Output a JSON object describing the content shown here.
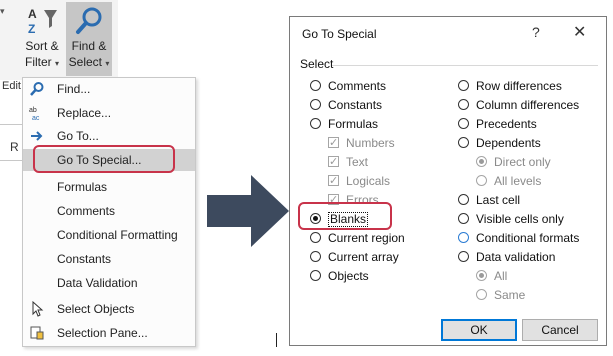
{
  "ribbon": {
    "sort_label_1": "Sort &",
    "sort_label_2": "Filter",
    "find_label_1": "Find &",
    "find_label_2": "Select",
    "dropdown_glyph": "▾",
    "edge_tag": "Edit",
    "cell_letter": "R"
  },
  "menu": {
    "items": [
      {
        "label": "Find...",
        "icon": "magnifier-icon"
      },
      {
        "label": "Replace...",
        "icon": "replace-icon"
      },
      {
        "label": "Go To...",
        "icon": "arrow-right-icon"
      },
      {
        "label": "Go To Special...",
        "icon": ""
      },
      {
        "label": "Formulas",
        "icon": ""
      },
      {
        "label": "Comments",
        "icon": ""
      },
      {
        "label": "Conditional Formatting",
        "icon": ""
      },
      {
        "label": "Constants",
        "icon": ""
      },
      {
        "label": "Data Validation",
        "icon": ""
      },
      {
        "label": "Select Objects",
        "icon": "pointer-icon"
      },
      {
        "label": "Selection Pane...",
        "icon": "selection-pane-icon"
      }
    ],
    "highlighted_index": 3
  },
  "dialog": {
    "title": "Go To Special",
    "help": "?",
    "close": "✕",
    "group_label": "Select",
    "left_options": [
      {
        "label": "Comments",
        "type": "radio",
        "selected": false,
        "disabled": false
      },
      {
        "label": "Constants",
        "type": "radio",
        "selected": false,
        "disabled": false
      },
      {
        "label": "Formulas",
        "type": "radio",
        "selected": false,
        "disabled": false
      },
      {
        "label": "Numbers",
        "type": "checkbox",
        "checked": true,
        "disabled": true
      },
      {
        "label": "Text",
        "type": "checkbox",
        "checked": true,
        "disabled": true
      },
      {
        "label": "Logicals",
        "type": "checkbox",
        "checked": true,
        "disabled": true
      },
      {
        "label": "Errors",
        "type": "checkbox",
        "checked": true,
        "disabled": true
      },
      {
        "label": "Blanks",
        "type": "radio",
        "selected": true,
        "disabled": false
      },
      {
        "label": "Current region",
        "type": "radio",
        "selected": false,
        "disabled": false
      },
      {
        "label": "Current array",
        "type": "radio",
        "selected": false,
        "disabled": false
      },
      {
        "label": "Objects",
        "type": "radio",
        "selected": false,
        "disabled": false
      }
    ],
    "right_options": [
      {
        "label": "Row differences",
        "type": "radio",
        "selected": false,
        "disabled": false
      },
      {
        "label": "Column differences",
        "type": "radio",
        "selected": false,
        "disabled": false
      },
      {
        "label": "Precedents",
        "type": "radio",
        "selected": false,
        "disabled": false
      },
      {
        "label": "Dependents",
        "type": "radio",
        "selected": false,
        "disabled": false
      },
      {
        "label": "Direct only",
        "type": "radio",
        "selected": true,
        "disabled": true
      },
      {
        "label": "All levels",
        "type": "radio",
        "selected": false,
        "disabled": true
      },
      {
        "label": "Last cell",
        "type": "radio",
        "selected": false,
        "disabled": false
      },
      {
        "label": "Visible cells only",
        "type": "radio",
        "selected": false,
        "disabled": false
      },
      {
        "label": "Conditional formats",
        "type": "radio",
        "selected": false,
        "disabled": false
      },
      {
        "label": "Data validation",
        "type": "radio",
        "selected": false,
        "disabled": false
      },
      {
        "label": "All",
        "type": "radio",
        "selected": true,
        "disabled": true
      },
      {
        "label": "Same",
        "type": "radio",
        "selected": false,
        "disabled": true
      }
    ],
    "ok_label": "OK",
    "cancel_label": "Cancel"
  },
  "colors": {
    "highlight_ring": "#c8334a",
    "arrow": "#3d4a5e",
    "menu_highlight": "#d2d2d2",
    "focus_blue": "#0078d7"
  }
}
